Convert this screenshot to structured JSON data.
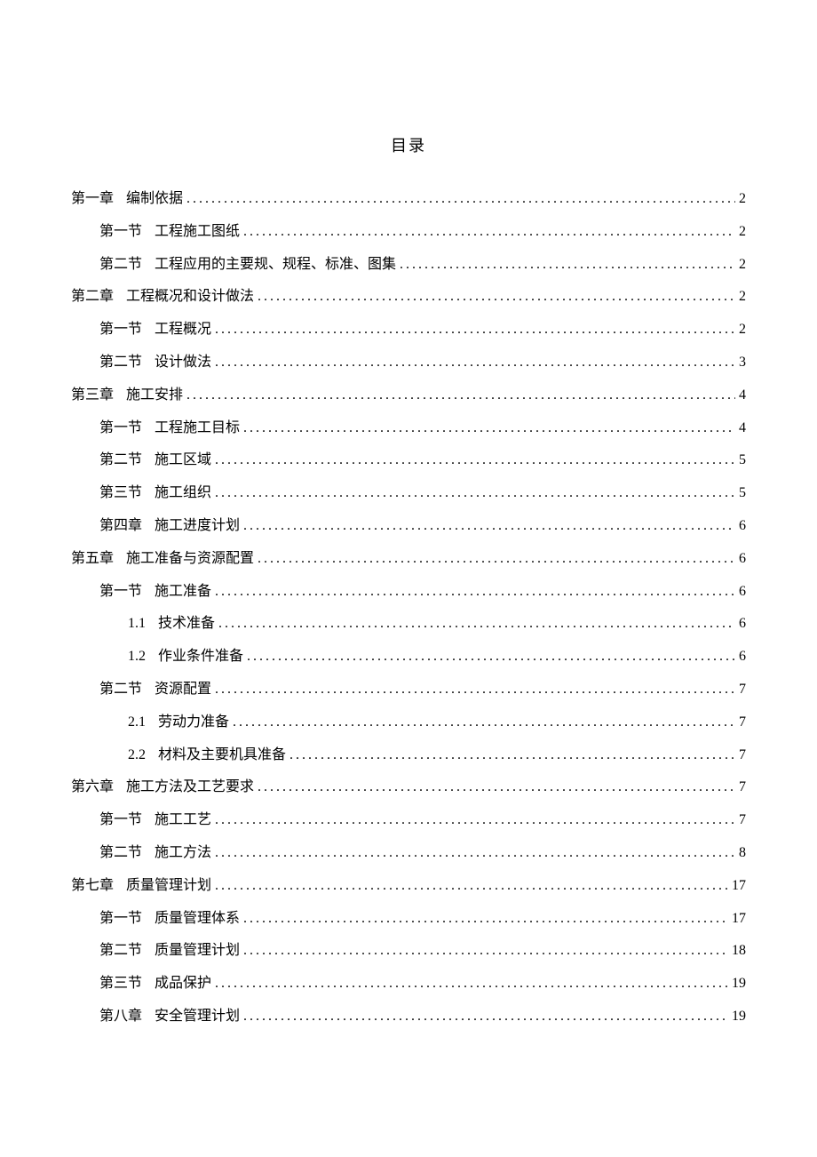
{
  "title": "目录",
  "entries": [
    {
      "indent": 0,
      "label": "第一章",
      "text": "编制依据",
      "page": "2"
    },
    {
      "indent": 1,
      "label": "第一节",
      "text": "工程施工图纸",
      "page": "2"
    },
    {
      "indent": 1,
      "label": "第二节",
      "text": "工程应用的主要规、规程、标准、图集",
      "page": "2"
    },
    {
      "indent": 0,
      "label": "第二章",
      "text": "工程概况和设计做法",
      "page": "2"
    },
    {
      "indent": 1,
      "label": "第一节",
      "text": "工程概况",
      "page": "2"
    },
    {
      "indent": 1,
      "label": "第二节",
      "text": "设计做法",
      "page": "3"
    },
    {
      "indent": 0,
      "label": "第三章",
      "text": "施工安排",
      "page": "4"
    },
    {
      "indent": 1,
      "label": "第一节",
      "text": "工程施工目标",
      "page": "4"
    },
    {
      "indent": 1,
      "label": "第二节",
      "text": "施工区域",
      "page": "5"
    },
    {
      "indent": 1,
      "label": "第三节",
      "text": "施工组织",
      "page": "5"
    },
    {
      "indent": 1,
      "label": "第四章",
      "text": "施工进度计划",
      "page": "6"
    },
    {
      "indent": 0,
      "label": "第五章",
      "text": "施工准备与资源配置",
      "page": "6"
    },
    {
      "indent": 1,
      "label": "第一节",
      "text": "施工准备",
      "page": "6"
    },
    {
      "indent": 2,
      "label": "1.1",
      "text": "技术准备",
      "page": "6"
    },
    {
      "indent": 2,
      "label": "1.2",
      "text": "作业条件准备",
      "page": "6"
    },
    {
      "indent": 1,
      "label": "第二节",
      "text": "资源配置",
      "page": "7"
    },
    {
      "indent": 2,
      "label": "2.1",
      "text": "劳动力准备",
      "page": "7"
    },
    {
      "indent": 2,
      "label": "2.2",
      "text": "材料及主要机具准备",
      "page": "7"
    },
    {
      "indent": 0,
      "label": "第六章",
      "text": "施工方法及工艺要求",
      "page": "7"
    },
    {
      "indent": 1,
      "label": "第一节",
      "text": "施工工艺",
      "page": "7"
    },
    {
      "indent": 1,
      "label": "第二节",
      "text": "施工方法",
      "page": "8"
    },
    {
      "indent": 0,
      "label": "第七章",
      "text": "质量管理计划",
      "page": "17"
    },
    {
      "indent": 1,
      "label": "第一节",
      "text": "质量管理体系",
      "page": "17"
    },
    {
      "indent": 1,
      "label": "第二节",
      "text": "质量管理计划",
      "page": "18"
    },
    {
      "indent": 1,
      "label": "第三节",
      "text": "成品保护",
      "page": "19"
    },
    {
      "indent": 1,
      "label": "第八章",
      "text": "安全管理计划",
      "page": "19"
    }
  ]
}
